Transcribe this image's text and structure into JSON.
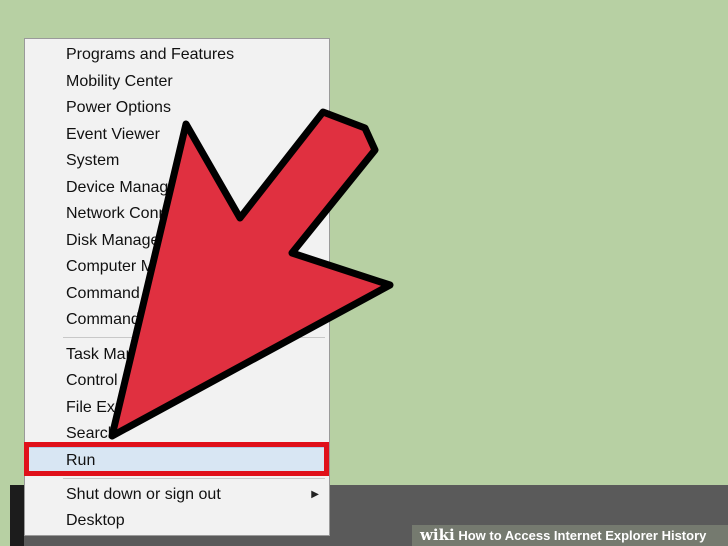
{
  "menu": {
    "groups": [
      [
        "Programs and Features",
        "Mobility Center",
        "Power Options",
        "Event Viewer",
        "System",
        "Device Manager",
        "Network Connections",
        "Disk Management",
        "Computer Management",
        "Command Prompt",
        "Command Prompt (Admin)"
      ],
      [
        "Task Manager",
        "Control Panel",
        "File Explorer",
        "Search",
        "Run"
      ],
      [
        "Shut down or sign out",
        "Desktop"
      ]
    ],
    "highlighted": "Run",
    "submenu_arrow": "▶"
  },
  "watermark": {
    "brand": "wiki",
    "text": "How to Access Internet Explorer History"
  },
  "colors": {
    "background": "#b7d0a3",
    "arrow_fill": "#e03040",
    "highlight_box": "#e0101a"
  }
}
